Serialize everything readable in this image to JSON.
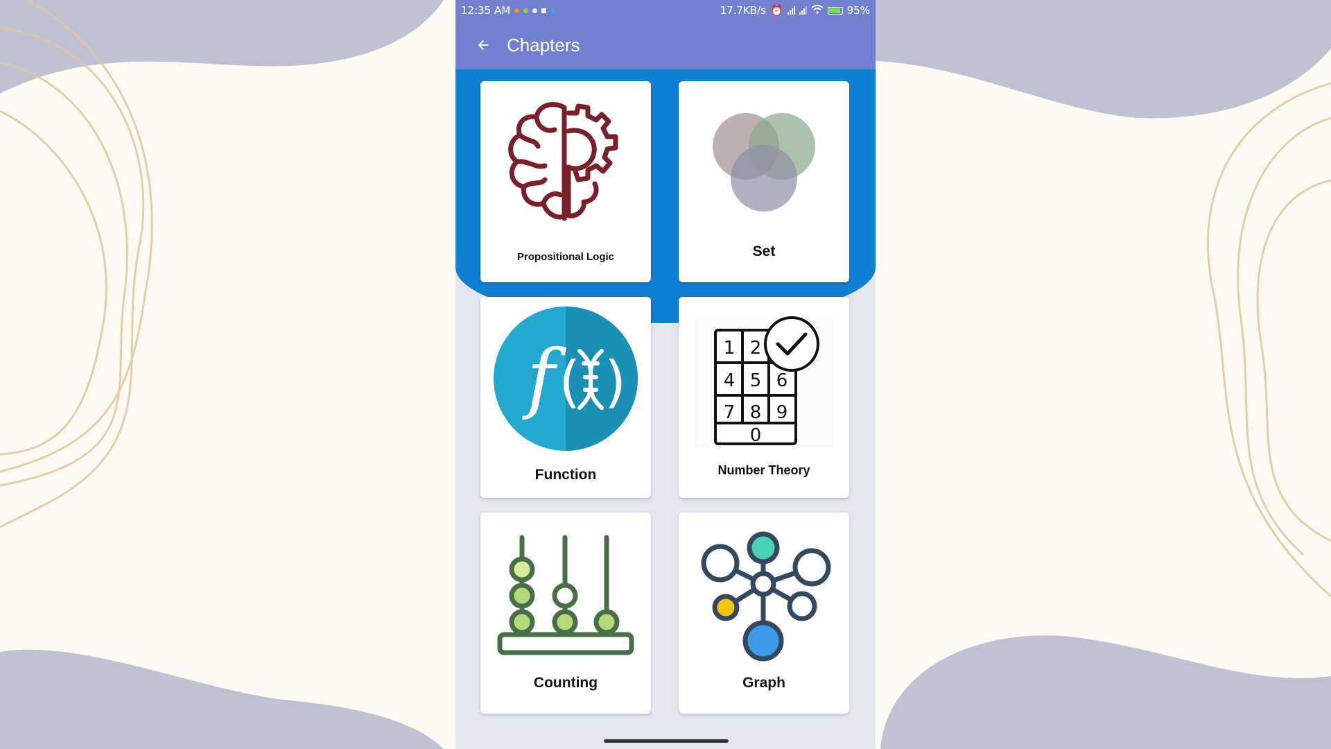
{
  "status_bar": {
    "time": "12:35 AM",
    "speed": "17.7KB/s",
    "battery": "95%",
    "icons": [
      "notification-icon",
      "alarm-icon",
      "signal-icon",
      "wifi-icon",
      "battery-icon"
    ]
  },
  "app_bar": {
    "title": "Chapters",
    "back_icon": "arrow-back-icon",
    "color": "#7380cf"
  },
  "header_color": "#0f7fd4",
  "chapters": [
    {
      "label": "Propositional Logic",
      "icon": "brain-gear-icon"
    },
    {
      "label": "Set",
      "icon": "venn-diagram-icon"
    },
    {
      "label": "Function",
      "icon": "function-fx-icon"
    },
    {
      "label": "Number Theory",
      "icon": "keypad-check-icon"
    },
    {
      "label": "Counting",
      "icon": "abacus-icon"
    },
    {
      "label": "Graph",
      "icon": "network-graph-icon"
    }
  ]
}
